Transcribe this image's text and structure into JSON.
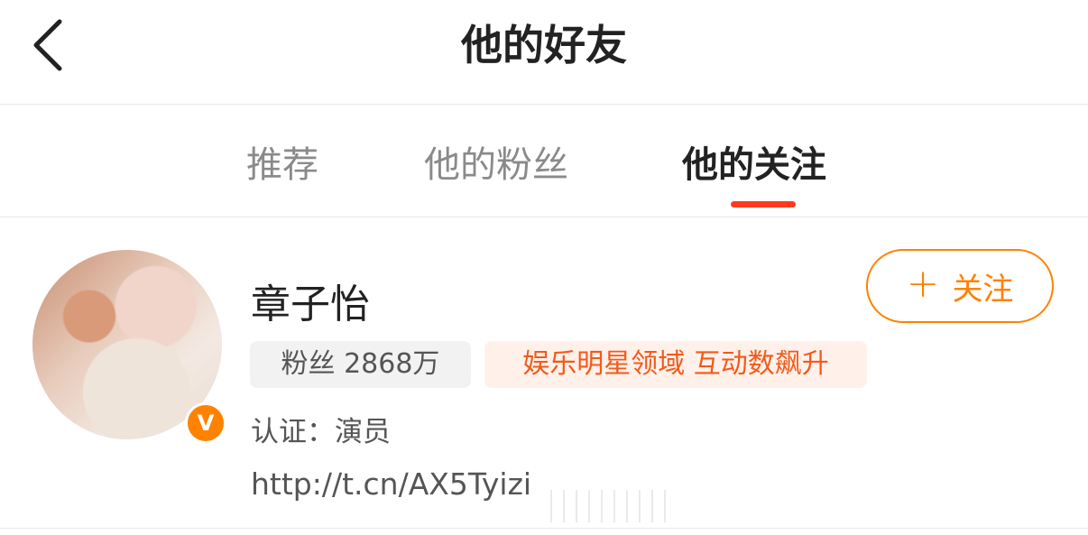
{
  "header": {
    "title": "他的好友"
  },
  "tabs": [
    {
      "label": "推荐",
      "active": false
    },
    {
      "label": "他的粉丝",
      "active": false
    },
    {
      "label": "他的关注",
      "active": true
    }
  ],
  "colors": {
    "accent": "#ff8200",
    "indicator": "#ff3b1f",
    "hot_text": "#f25a1b",
    "hot_bg": "#fff1ea"
  },
  "user": {
    "name": "章子怡",
    "follow_label": "关注",
    "fans_tag": "粉丝 2868万",
    "hot_tag": "娱乐明星领域 互动数飙升",
    "verify_label": "认证：",
    "verify_value": "演员",
    "link": "http://t.cn/AX5Tyizi",
    "badge_letter": "V"
  },
  "icons": [
    "back-arrow-icon",
    "plus-icon",
    "verified-v-icon"
  ]
}
